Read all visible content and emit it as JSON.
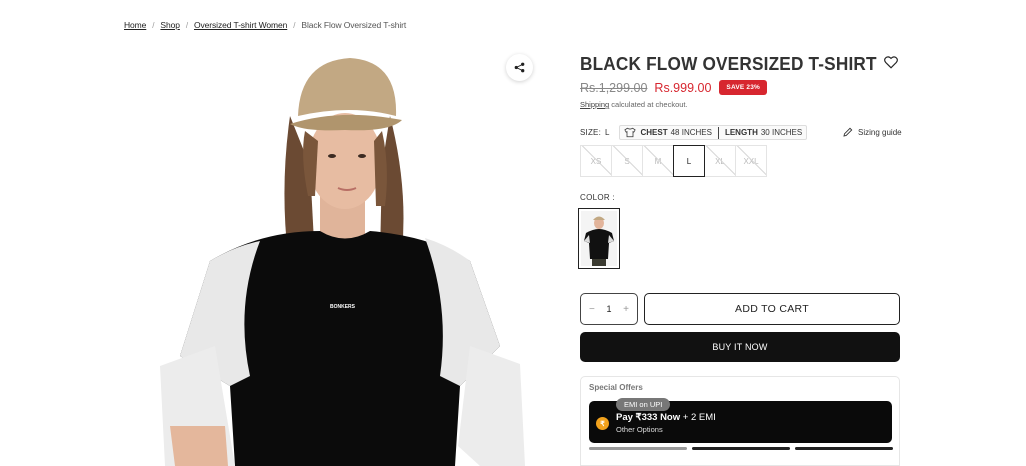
{
  "breadcrumb": {
    "items": [
      "Home",
      "Shop",
      "Oversized T-shirt Women"
    ],
    "current": "Black Flow Oversized T-shirt"
  },
  "product": {
    "title": "BLACK FLOW OVERSIZED T-SHIRT",
    "price_old": "Rs.1,299.00",
    "price_new": "Rs.999.00",
    "save_badge": "SAVE 23%",
    "shipping_link": "Shipping",
    "shipping_text": " calculated at checkout.",
    "print_text": "BONKERS"
  },
  "size": {
    "label": "SIZE:",
    "selected": "L",
    "chest_label": "CHEST",
    "chest_value": "48 INCHES",
    "length_label": "LENGTH",
    "length_value": "30 INCHES",
    "guide_label": "Sizing guide",
    "options": [
      "XS",
      "S",
      "M",
      "L",
      "XL",
      "XXL"
    ]
  },
  "color": {
    "label": "COLOR :"
  },
  "cart": {
    "quantity": "1",
    "minus": "−",
    "plus": "+",
    "add_label": "ADD TO CART",
    "buy_label": "BUY IT NOW"
  },
  "offers": {
    "title": "Special Offers",
    "emi_tag": "EMI on UPI",
    "emi_pay": "Pay ₹333 Now",
    "emi_rest": " + 2 EMI",
    "emi_sub": "Other Options",
    "icon_symbol": "₹"
  },
  "colors": {
    "accent_red": "#d7262f",
    "button_black": "#111111",
    "emi_orange": "#f2a21d"
  },
  "icons": [
    "share-icon",
    "heart-icon",
    "tshirt-icon",
    "pencil-icon",
    "rupee-coin-icon"
  ]
}
